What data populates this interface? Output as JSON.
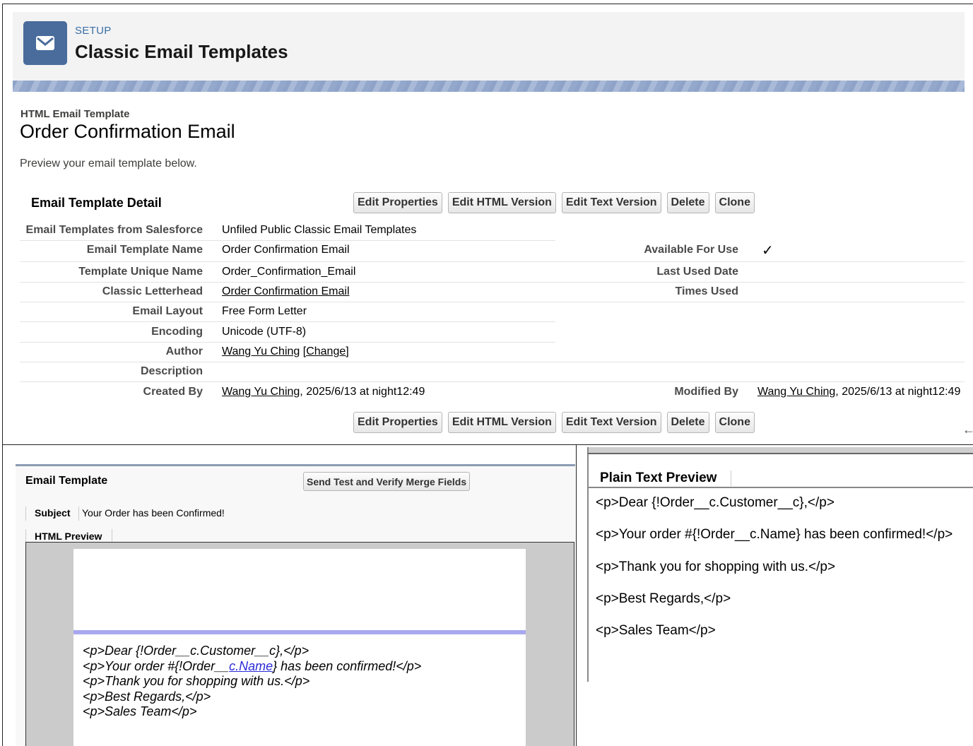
{
  "header": {
    "setup_label": "SETUP",
    "title": "Classic Email Templates",
    "icon": "envelope-icon"
  },
  "record": {
    "type": "HTML Email Template",
    "name": "Order Confirmation Email",
    "hint": "Preview your email template below."
  },
  "detail": {
    "title": "Email Template Detail",
    "buttons": [
      "Edit Properties",
      "Edit HTML Version",
      "Edit Text Version",
      "Delete",
      "Clone"
    ],
    "fields": {
      "folder_label": "Email Templates from Salesforce",
      "folder_value": "Unfiled Public Classic Email Templates",
      "name_label": "Email Template Name",
      "name_value": "Order Confirmation Email",
      "unique_label": "Template Unique Name",
      "unique_value": "Order_Confirmation_Email",
      "letterhead_label": "Classic Letterhead",
      "letterhead_value": "Order Confirmation Email",
      "layout_label": "Email Layout",
      "layout_value": "Free Form Letter",
      "encoding_label": "Encoding",
      "encoding_value": "Unicode (UTF-8)",
      "author_label": "Author",
      "author_value": "Wang Yu Ching",
      "author_change": "[Change]",
      "description_label": "Description",
      "created_label": "Created By",
      "created_user": "Wang Yu Ching",
      "created_date": ", 2025/6/13 at night12:49",
      "available_label": "Available For Use",
      "available_check": "✓",
      "last_used_label": "Last Used Date",
      "times_used_label": "Times Used",
      "modified_label": "Modified By",
      "modified_user": "Wang Yu Ching",
      "modified_date": ", 2025/6/13 at night12:49"
    }
  },
  "email_template": {
    "title": "Email Template",
    "send_test_label": "Send Test and Verify Merge Fields",
    "subject_label": "Subject",
    "subject_value": "Your Order has been Confirmed!",
    "html_preview_label": "HTML Preview",
    "body_lines": {
      "l1": "<p>Dear {!Order__c.Customer__c},</p>",
      "l2_pre": "<p>Your order #{!Order__",
      "l2_link": "c.Name",
      "l2_post": "} has been confirmed!</p>",
      "l3": "<p>Thank you for shopping with us.</p>",
      "l4": "<p>Best Regards,</p>",
      "l5": "<p>Sales Team</p>"
    }
  },
  "plain_text": {
    "title": "Plain Text Preview",
    "lines": [
      "<p>Dear {!Order__c.Customer__c},</p>",
      "<p>Your order #{!Order__c.Name} has been confirmed!</p>",
      "<p>Thank you for shopping with us.</p>",
      "<p>Best Regards,</p>",
      "<p>Sales Team</p>"
    ]
  },
  "colors": {
    "icon_bg": "#4a6c9c",
    "setup_label": "#3a6ea5",
    "letterhead_line": "#a8a8f0",
    "merge_link": "#2a2ad8"
  }
}
